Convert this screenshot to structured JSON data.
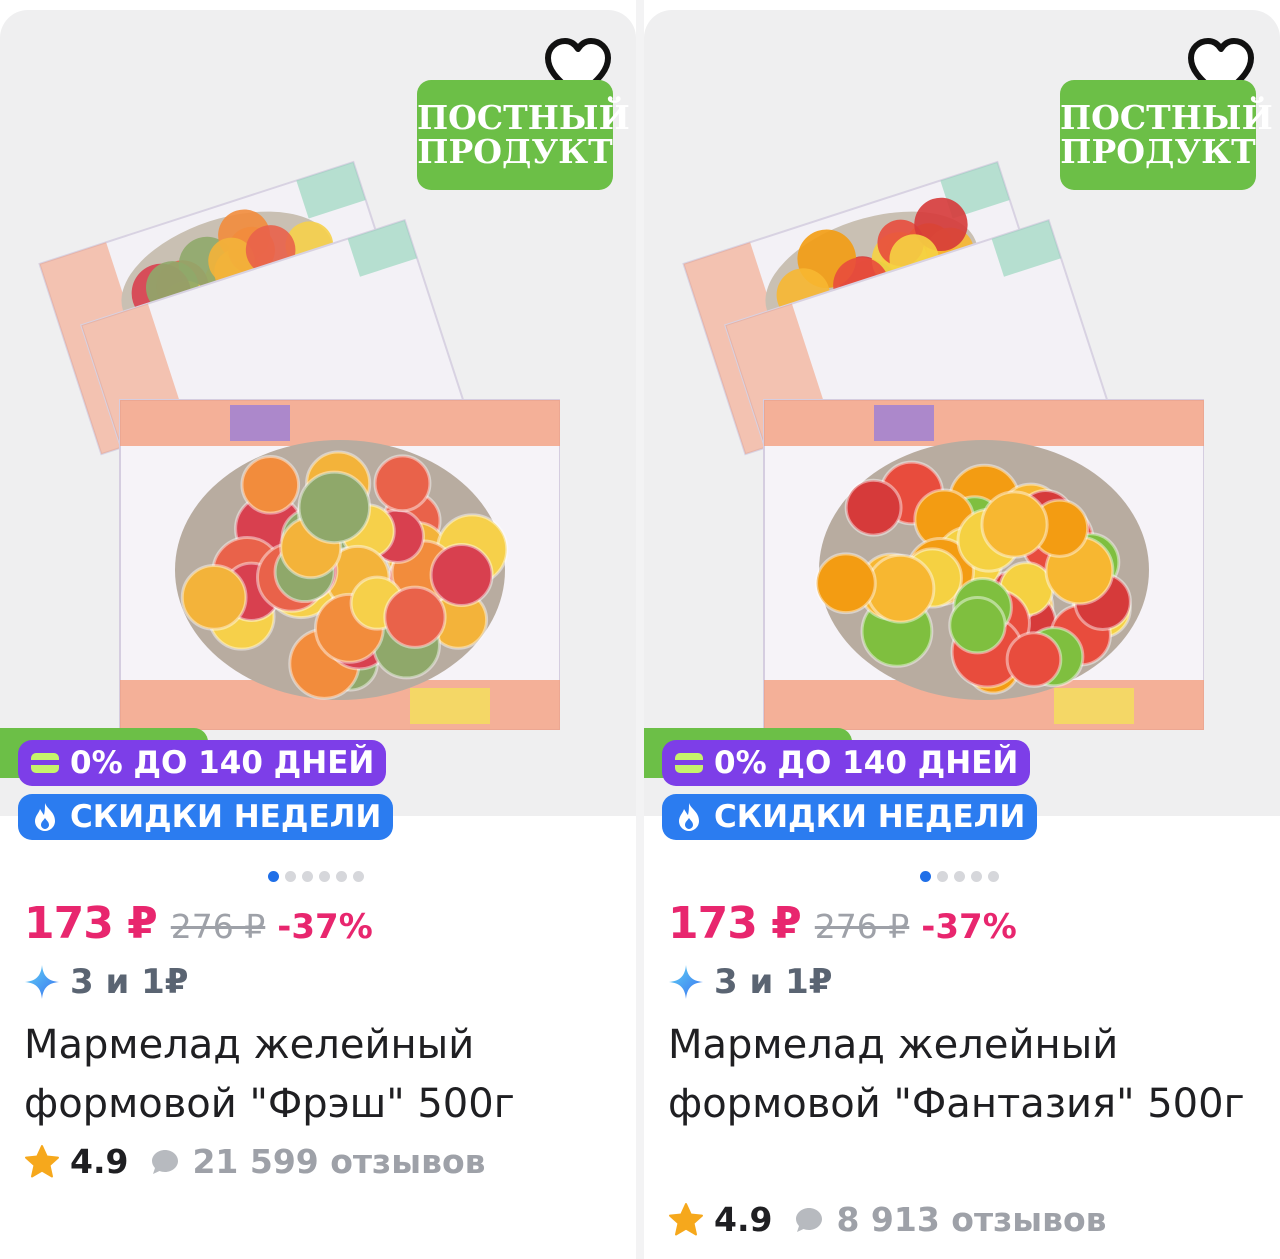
{
  "products": [
    {
      "lenten_line1": "ПОСТНЫЙ",
      "lenten_line2": "ПРОДУКТ",
      "installment_badge": "0% ДО 140 ДНЕЙ",
      "sale_badge": "СКИДКИ НЕДЕЛИ",
      "carousel_total": 6,
      "carousel_active": 1,
      "price": "173 ₽",
      "old_price": "276 ₽",
      "discount": "-37%",
      "cashback": "3 и 1₽",
      "title": "Мармелад желейный формовой \"Фрэш\" 500г",
      "rating": "4.9",
      "reviews": "21 599 отзывов",
      "candy_colors": [
        "#f3b33a",
        "#e9624a",
        "#d8404f",
        "#8fa86a",
        "#f28c3c",
        "#f6d04a"
      ]
    },
    {
      "lenten_line1": "ПОСТНЫЙ",
      "lenten_line2": "ПРОДУКТ",
      "installment_badge": "0% ДО 140 ДНЕЙ",
      "sale_badge": "СКИДКИ НЕДЕЛИ",
      "carousel_total": 5,
      "carousel_active": 1,
      "price": "173 ₽",
      "old_price": "276 ₽",
      "discount": "-37%",
      "cashback": "3 и 1₽",
      "title": "Мармелад желейный формовой \"Фантазия\" 500г",
      "rating": "4.9",
      "reviews": "8 913 отзывов",
      "candy_colors": [
        "#f7b731",
        "#e84c3d",
        "#7fbf3f",
        "#f39c12",
        "#d63a3a",
        "#f5d142"
      ]
    }
  ],
  "colors": {
    "price": "#e8266e",
    "lenten_badge": "#6cbf47",
    "installment_badge": "#7d3ee8",
    "sale_badge": "#2b7cf0"
  }
}
